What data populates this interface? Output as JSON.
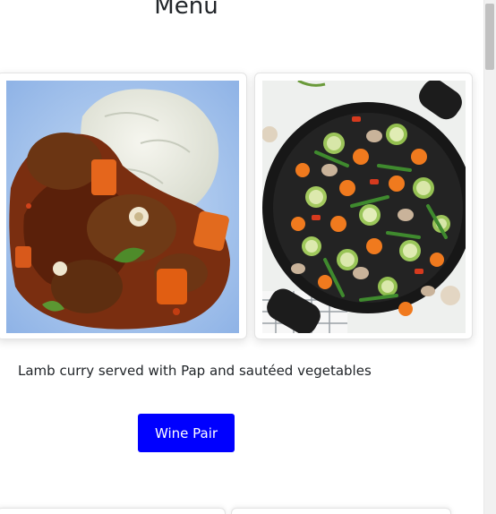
{
  "page": {
    "title": "Menu"
  },
  "dishes": [
    {
      "image_icon": "lamb-curry-photo"
    },
    {
      "image_icon": "sauteed-vegetables-photo"
    }
  ],
  "dish": {
    "description": "Lamb curry served with Pap and sautéed vegetables",
    "button_label": "Wine Pair"
  },
  "colors": {
    "button_background": "#0000ff",
    "button_text": "#ffffff"
  }
}
